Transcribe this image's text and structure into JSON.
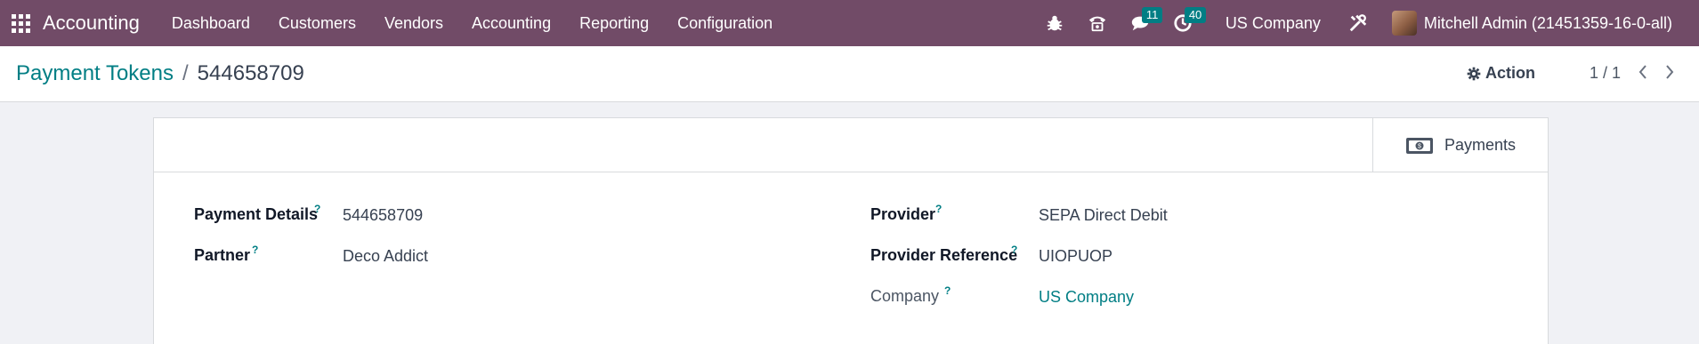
{
  "navbar": {
    "app_name": "Accounting",
    "menu": [
      "Dashboard",
      "Customers",
      "Vendors",
      "Accounting",
      "Reporting",
      "Configuration"
    ],
    "messages_count": "11",
    "activities_count": "40",
    "company": "US Company",
    "user": "Mitchell Admin (21451359-16-0-all)",
    "accent_color": "#714b67",
    "badge_color": "#017e84"
  },
  "breadcrumb": {
    "parent": "Payment Tokens",
    "separator": "/",
    "current": "544658709"
  },
  "control": {
    "action_label": "Action",
    "pager": "1 / 1"
  },
  "smart_button": {
    "label": "Payments",
    "icon": "money-icon"
  },
  "form": {
    "left": [
      {
        "label": "Payment Details",
        "help": "?",
        "value": "544658709"
      },
      {
        "label": "Partner",
        "help": "?",
        "value": "Deco Addict"
      }
    ],
    "right": [
      {
        "label": "Provider",
        "help": "?",
        "value": "SEPA Direct Debit"
      },
      {
        "label": "Provider Reference",
        "help": "?",
        "value": "UIOPUOP"
      },
      {
        "label": "Company",
        "help": "?",
        "value": "US Company"
      }
    ]
  }
}
